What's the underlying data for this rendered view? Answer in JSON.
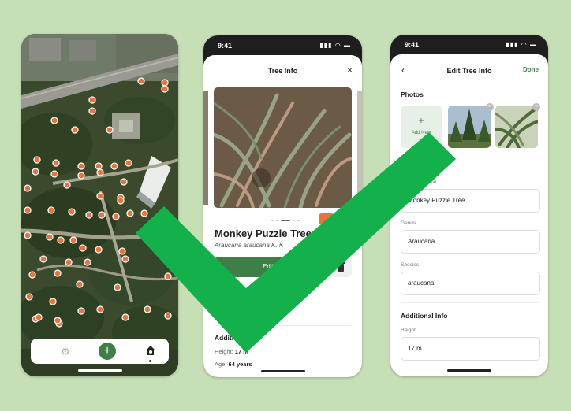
{
  "colors": {
    "background": "#c6dfb6",
    "accent_green": "#3f7f47",
    "marker_orange": "#e8733c",
    "checkmark_green": "#14b04b"
  },
  "map_screen": {
    "nav": {
      "settings_icon": "gear-icon",
      "add_icon": "plus-icon",
      "add_label": "+",
      "trees_icon": "tree-icon"
    }
  },
  "tree_info_screen": {
    "status_time": "9:41",
    "title": "Tree Info",
    "close_label": "×",
    "tree_name": "Monkey Puzzle Tree",
    "scientific_name": "Araucaria araucana K. K",
    "edit_label": "Edit",
    "delete_icon": "trash-icon",
    "additional_title": "Additional Info",
    "height_label": "Height:",
    "height_value": "17 m",
    "age_label": "Age:",
    "age_value": "64 years"
  },
  "edit_screen": {
    "status_time": "9:41",
    "back_label": "‹",
    "title": "Edit Tree Info",
    "done_label": "Done",
    "photos_title": "Photos",
    "add_new_plus": "+",
    "add_new_label": "Add New",
    "common_name_label": "Common Name",
    "common_name_value": "Monkey Puzzle Tree",
    "genus_label": "Genus",
    "genus_value": "Araucaria",
    "species_label": "Species",
    "species_value": "araucana",
    "additional_title": "Additional Info",
    "height_label": "Height",
    "height_value": "17 m"
  }
}
